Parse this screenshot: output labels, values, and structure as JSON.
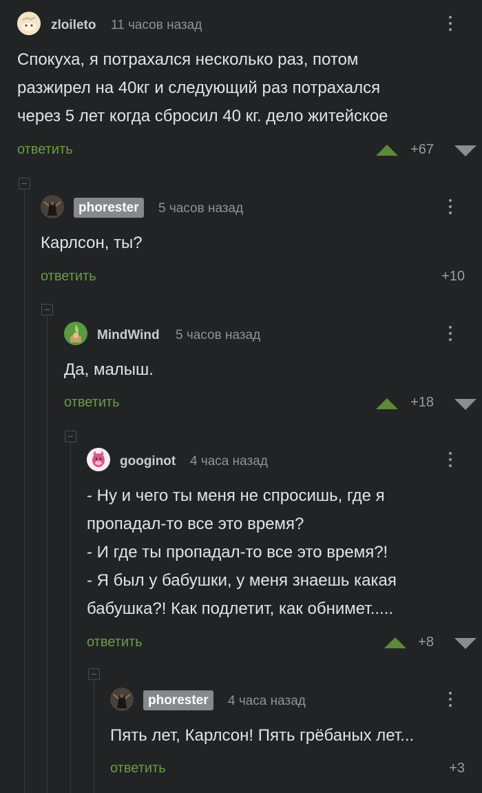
{
  "colors": {
    "background": "#212325",
    "reply_link": "#6a9c45",
    "vote_up": "#5a8a3a",
    "vote_down": "#8a8d91",
    "text": "#e1e3e6",
    "muted": "#8f9296"
  },
  "comments": [
    {
      "username": "zloileto",
      "time": "11 часов назад",
      "body": [
        "Спокуха, я потрахался несколько раз, потом",
        "разжирел на 40кг  и следующий раз потрахался",
        "через 5 лет когда сбросил 40 кг. дело житейское"
      ],
      "reply_label": "ответить",
      "rating": "+67"
    },
    {
      "username": "phorester",
      "time": "5 часов назад",
      "body": [
        "Карлсон, ты?"
      ],
      "reply_label": "ответить",
      "rating": "+10"
    },
    {
      "username": "MindWind",
      "time": "5 часов назад",
      "body": [
        "Да, малыш."
      ],
      "reply_label": "ответить",
      "rating": "+18"
    },
    {
      "username": "googinot",
      "time": "4 часа назад",
      "body": [
        "- Ну и чего ты меня не спросишь, где я",
        "пропадал-то все это время?",
        "- И где ты пропадал-то все это время?!",
        "- Я был у бабушки, у меня знаешь какая",
        "бабушка?! Как подлетит, как обнимет....."
      ],
      "reply_label": "ответить",
      "rating": "+8"
    },
    {
      "username": "phorester",
      "time": "4 часа назад",
      "body": [
        "Пять лет, Карлсон! Пять грёбаных лет..."
      ],
      "reply_label": "ответить",
      "rating": "+3"
    }
  ]
}
